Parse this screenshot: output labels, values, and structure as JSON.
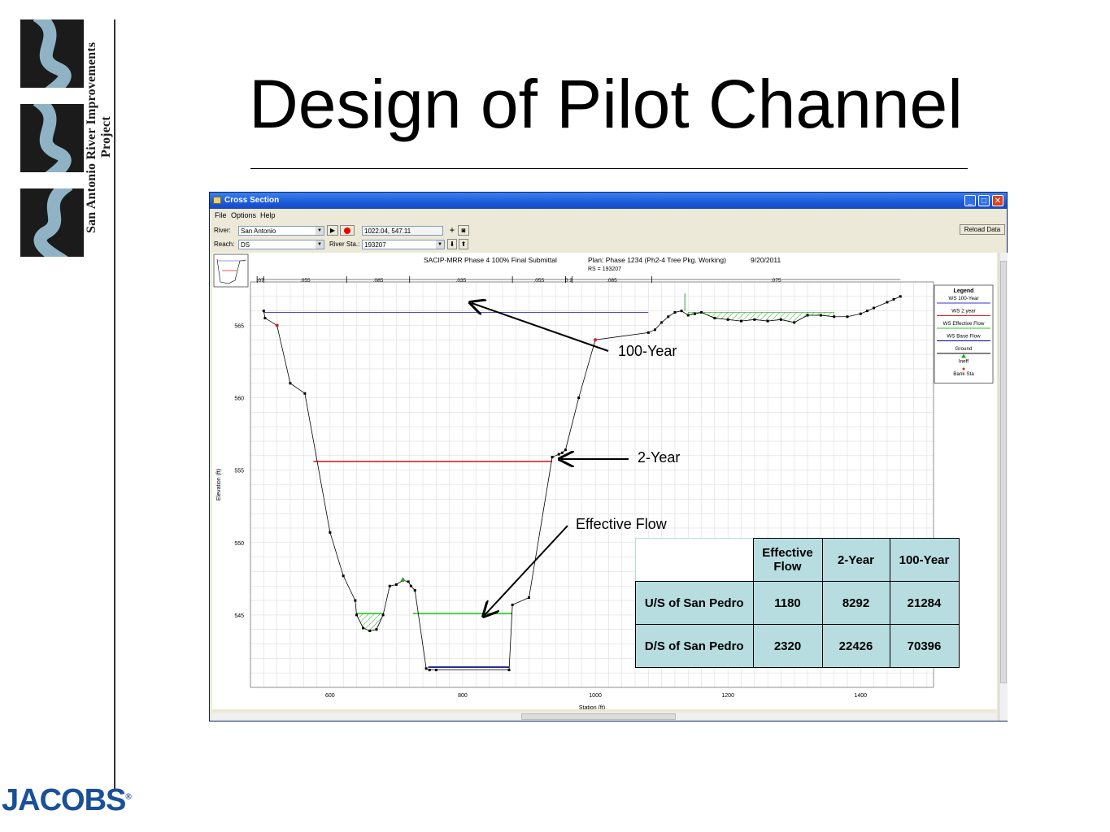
{
  "slide": {
    "title": "Design of Pilot Channel",
    "side_logo_text": "San Antonio River Improvements Project",
    "company_logo": "JACOBS",
    "company_logo_mark": "®"
  },
  "window": {
    "title": "Cross Section",
    "menu": [
      "File",
      "Options",
      "Help"
    ],
    "river_label": "River:",
    "river_value": "San Antonio",
    "reach_label": "Reach:",
    "reach_value": "DS",
    "river_sta_label": "River Sta.:",
    "river_sta_value": "193207",
    "coords_value": "1022.04, 547.11",
    "reload_button": "Reload Data"
  },
  "chart_data": {
    "type": "line",
    "title": "SACIP-MRR Phase 4 100% Final Submittal",
    "plan": "Plan: Phase 1234 (Ph2-4 Tree Pkg. Working)",
    "date": "9/20/2011",
    "subtitle": "RS = 193207",
    "xlabel": "Station (ft)",
    "ylabel": "Elevation (ft)",
    "xlim": [
      480,
      1510
    ],
    "ylim": [
      540,
      568
    ],
    "xticks": [
      600,
      800,
      1000,
      1200,
      1400
    ],
    "yticks": [
      545,
      550,
      555,
      560,
      565
    ],
    "grid": true,
    "legend_position": "right",
    "legend_title": "Legend",
    "legend_entries": [
      {
        "name": "WS 100-Year",
        "color": "#3333cc"
      },
      {
        "name": "WS 2 year",
        "color": "#e02020"
      },
      {
        "name": "WS Effective Flow",
        "color": "#22cc22"
      },
      {
        "name": "WS Base Flow",
        "color": "#000088"
      },
      {
        "name": "Ground",
        "color": "#000000"
      },
      {
        "name": "Ineff",
        "color": "#22aa22"
      },
      {
        "name": "Bank Sta",
        "color": "#e02020"
      }
    ],
    "mannings_n": [
      {
        "value": ".07",
        "x0": 490,
        "x1": 500
      },
      {
        "value": ".055",
        "x0": 500,
        "x1": 625
      },
      {
        "value": ".085",
        "x0": 625,
        "x1": 720
      },
      {
        "value": ".035",
        "x0": 720,
        "x1": 875
      },
      {
        "value": ".055",
        "x0": 875,
        "x1": 955
      },
      {
        "value": "0 2",
        "x0": 955,
        "x1": 965
      },
      {
        "value": ".085",
        "x0": 965,
        "x1": 1085
      },
      {
        "value": ".075",
        "x0": 1085,
        "x1": 1460
      }
    ],
    "ground": {
      "x": [
        500,
        502,
        520,
        540,
        562,
        600,
        620,
        638,
        640,
        650,
        660,
        670,
        680,
        690,
        700,
        710,
        718,
        722,
        728,
        745,
        750,
        760,
        870,
        875,
        900,
        935,
        945,
        950,
        955,
        975,
        1000,
        1080,
        1090,
        1100,
        1110,
        1120,
        1130,
        1140,
        1150,
        1160,
        1180,
        1200,
        1220,
        1240,
        1260,
        1280,
        1300,
        1320,
        1340,
        1360,
        1380,
        1400,
        1410,
        1420,
        1440,
        1450,
        1460
      ],
      "y": [
        566.0,
        565.5,
        565.0,
        561.0,
        560.3,
        550.7,
        547.7,
        546.0,
        545.0,
        544.1,
        543.9,
        544.0,
        545.0,
        547.0,
        547.1,
        547.4,
        547.3,
        547.0,
        546.7,
        541.3,
        541.2,
        541.2,
        541.2,
        545.7,
        546.2,
        555.9,
        556.1,
        556.2,
        556.4,
        560.0,
        564.0,
        564.5,
        564.7,
        565.2,
        565.6,
        565.9,
        566.0,
        565.7,
        565.8,
        565.9,
        565.5,
        565.4,
        565.3,
        565.4,
        565.3,
        565.4,
        565.2,
        565.7,
        565.7,
        565.6,
        565.6,
        565.8,
        566.0,
        566.2,
        566.6,
        566.8,
        567.0
      ]
    },
    "water_surfaces": [
      {
        "name": "WS 100-Year",
        "elevation": 565.9,
        "x0": 500,
        "x1": 1080
      },
      {
        "name": "WS 2 year",
        "elevation": 555.6,
        "x0": 575,
        "x1": 935
      },
      {
        "name": "WS Effective Flow",
        "elevation": 545.1,
        "x0": 725,
        "x1": 875
      },
      {
        "name": "WS Effective Flow",
        "elevation": 545.1,
        "x0": 640,
        "x1": 678
      },
      {
        "name": "WS Base Flow",
        "elevation": 541.4,
        "x0": 748,
        "x1": 870
      }
    ],
    "bank_stations": [
      {
        "x": 520,
        "y": 565.0
      },
      {
        "x": 1000,
        "y": 564.0
      }
    ]
  },
  "annotations": {
    "hundred_year": "100-Year",
    "two_year": "2-Year",
    "effective_flow": "Effective Flow"
  },
  "flow_table": {
    "headers": [
      "Effective Flow",
      "2-Year",
      "100-Year"
    ],
    "rows": [
      {
        "label": "U/S of San Pedro",
        "values": [
          "1180",
          "8292",
          "21284"
        ]
      },
      {
        "label": "D/S of San Pedro",
        "values": [
          "2320",
          "22426",
          "70396"
        ]
      }
    ]
  }
}
